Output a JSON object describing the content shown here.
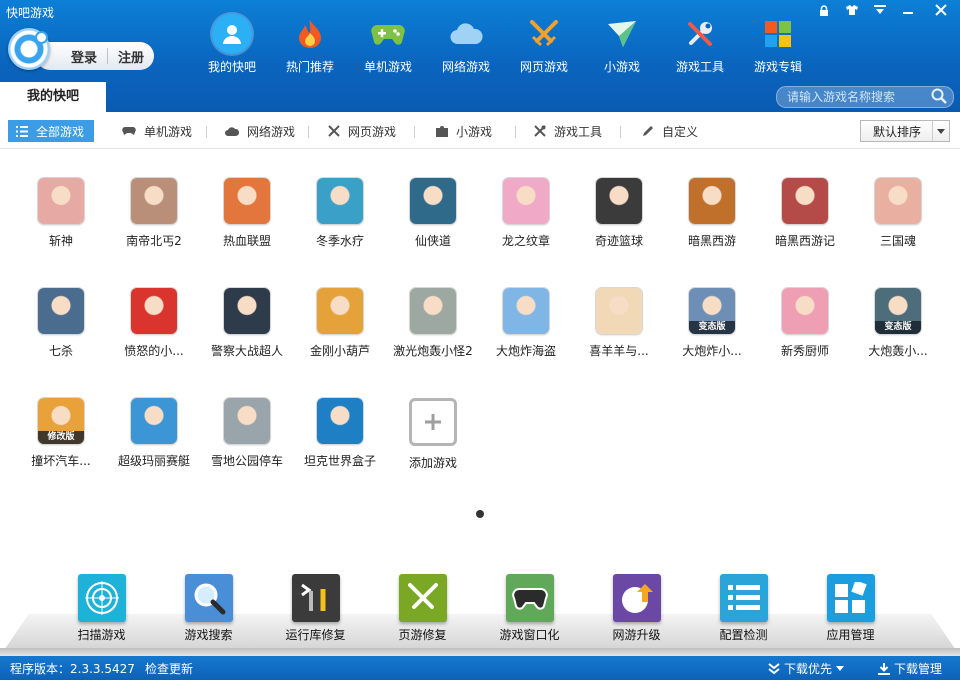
{
  "window": {
    "title": "快吧游戏"
  },
  "account": {
    "login": "登录",
    "register": "注册"
  },
  "nav": [
    {
      "label": "我的快吧"
    },
    {
      "label": "热门推荐"
    },
    {
      "label": "单机游戏"
    },
    {
      "label": "网络游戏"
    },
    {
      "label": "网页游戏"
    },
    {
      "label": "小游戏"
    },
    {
      "label": "游戏工具"
    },
    {
      "label": "游戏专辑"
    }
  ],
  "tab": {
    "label": "我的快吧"
  },
  "search": {
    "placeholder": "请输入游戏名称搜索"
  },
  "filters": [
    {
      "label": "全部游戏"
    },
    {
      "label": "单机游戏"
    },
    {
      "label": "网络游戏"
    },
    {
      "label": "网页游戏"
    },
    {
      "label": "小游戏"
    },
    {
      "label": "游戏工具"
    },
    {
      "label": "自定义"
    }
  ],
  "sort": {
    "selected": "默认排序"
  },
  "games": [
    {
      "name": "斩神",
      "color": "#e7a9a3"
    },
    {
      "name": "南帝北丐2",
      "color": "#b98f7a"
    },
    {
      "name": "热血联盟",
      "color": "#e2763d"
    },
    {
      "name": "冬季水疗",
      "color": "#3aa0c8"
    },
    {
      "name": "仙侠道",
      "color": "#2f6a8a"
    },
    {
      "name": "龙之纹章",
      "color": "#f0a9c6"
    },
    {
      "name": "奇迹篮球",
      "color": "#3b3b3b"
    },
    {
      "name": "暗黑西游",
      "color": "#c0702a"
    },
    {
      "name": "暗黑西游记",
      "color": "#b54b48"
    },
    {
      "name": "三国魂",
      "color": "#e9b0a2"
    },
    {
      "name": "七杀",
      "color": "#4a6c8f"
    },
    {
      "name": "愤怒的小...",
      "color": "#d9352e"
    },
    {
      "name": "警察大战超人",
      "color": "#2e3b4a"
    },
    {
      "name": "金刚小葫芦",
      "color": "#e6a23a"
    },
    {
      "name": "激光炮轰小怪2",
      "color": "#9ea8a2"
    },
    {
      "name": "大炮炸海盗",
      "color": "#7fb6e5"
    },
    {
      "name": "喜羊羊与...",
      "color": "#f1d9b8"
    },
    {
      "name": "大炮炸小...",
      "color": "#6d8fb5"
    },
    {
      "name": "新秀厨师",
      "color": "#ee9fb3"
    },
    {
      "name": "大炮轰小...",
      "color": "#4e6d7a"
    },
    {
      "name": "撞坏汽车...",
      "color": "#e9a13a"
    },
    {
      "name": "超级玛丽赛艇",
      "color": "#3c95d4"
    },
    {
      "name": "雪地公园停车",
      "color": "#9aa4ab"
    },
    {
      "name": "坦克世界盒子",
      "color": "#1f7fc4"
    }
  ],
  "badges": {
    "mod": "修改版",
    "var": "变态版"
  },
  "add_game": {
    "label": "添加游戏"
  },
  "tools": [
    {
      "label": "扫描游戏",
      "color": "#1fb2d8"
    },
    {
      "label": "游戏搜索",
      "color": "#4a8ed8"
    },
    {
      "label": "运行库修复",
      "color": "#3b3b3b"
    },
    {
      "label": "页游修复",
      "color": "#7aa824"
    },
    {
      "label": "游戏窗口化",
      "color": "#62a85a"
    },
    {
      "label": "网游升级",
      "color": "#6b47a6"
    },
    {
      "label": "配置检测",
      "color": "#2ba5d8"
    },
    {
      "label": "应用管理",
      "color": "#1b9ee0"
    }
  ],
  "status": {
    "version": "程序版本：2.3.3.5427",
    "check_update": "检查更新",
    "download_priority": "下载优先",
    "download_manager": "下载管理"
  }
}
